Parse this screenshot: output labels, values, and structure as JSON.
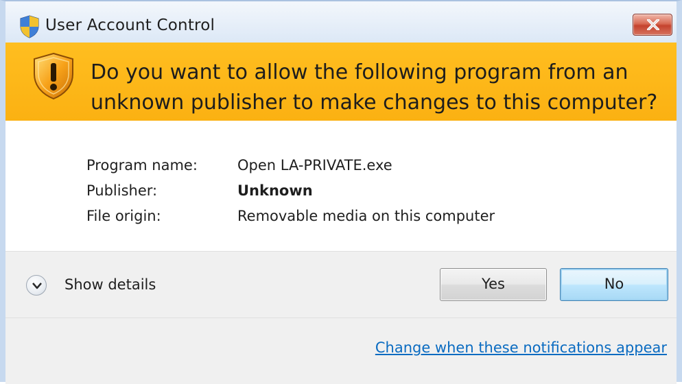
{
  "window": {
    "title": "User Account Control",
    "close_symbol": "×"
  },
  "banner": {
    "question": "Do you want to allow the following program from an unknown publisher to make changes to this computer?",
    "icon": "warning-shield-icon",
    "color": "#fbb112"
  },
  "info": {
    "program_name_label": "Program name:",
    "program_name_value": "Open LA-PRIVATE.exe",
    "publisher_label": "Publisher:",
    "publisher_value": "Unknown",
    "file_origin_label": "File origin:",
    "file_origin_value": "Removable media on this computer"
  },
  "footer": {
    "show_details_label": "Show details",
    "yes_label": "Yes",
    "no_label": "No",
    "notification_link": "Change when these notifications appear",
    "link_color": "#0a6bc1"
  }
}
